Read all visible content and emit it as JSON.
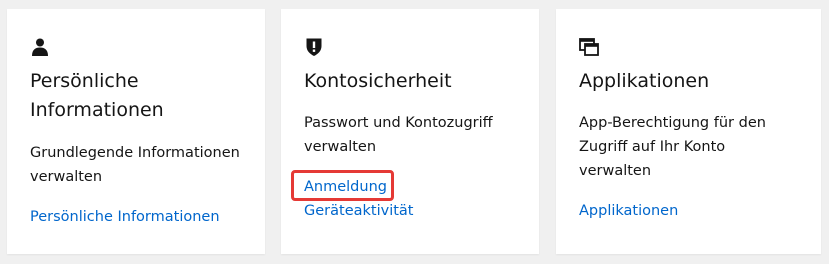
{
  "cards": [
    {
      "icon": "user-icon",
      "title": "Persönliche Informationen",
      "description": "Grundlegende Informationen verwalten",
      "links": [
        "Persönliche Informationen"
      ]
    },
    {
      "icon": "shield-icon",
      "title": "Kontosicherheit",
      "description": "Passwort und Kontozugriff verwalten",
      "links": [
        "Anmeldung",
        "Geräteaktivität"
      ]
    },
    {
      "icon": "applications-icon",
      "title": "Applikationen",
      "description": "App-Berechtigung für den Zugriff auf Ihr Konto verwalten",
      "links": [
        "Applikationen"
      ]
    }
  ],
  "colors": {
    "background": "#f0f0f0",
    "card": "#ffffff",
    "text": "#151515",
    "link": "#0066cc",
    "highlight": "#e53935"
  }
}
